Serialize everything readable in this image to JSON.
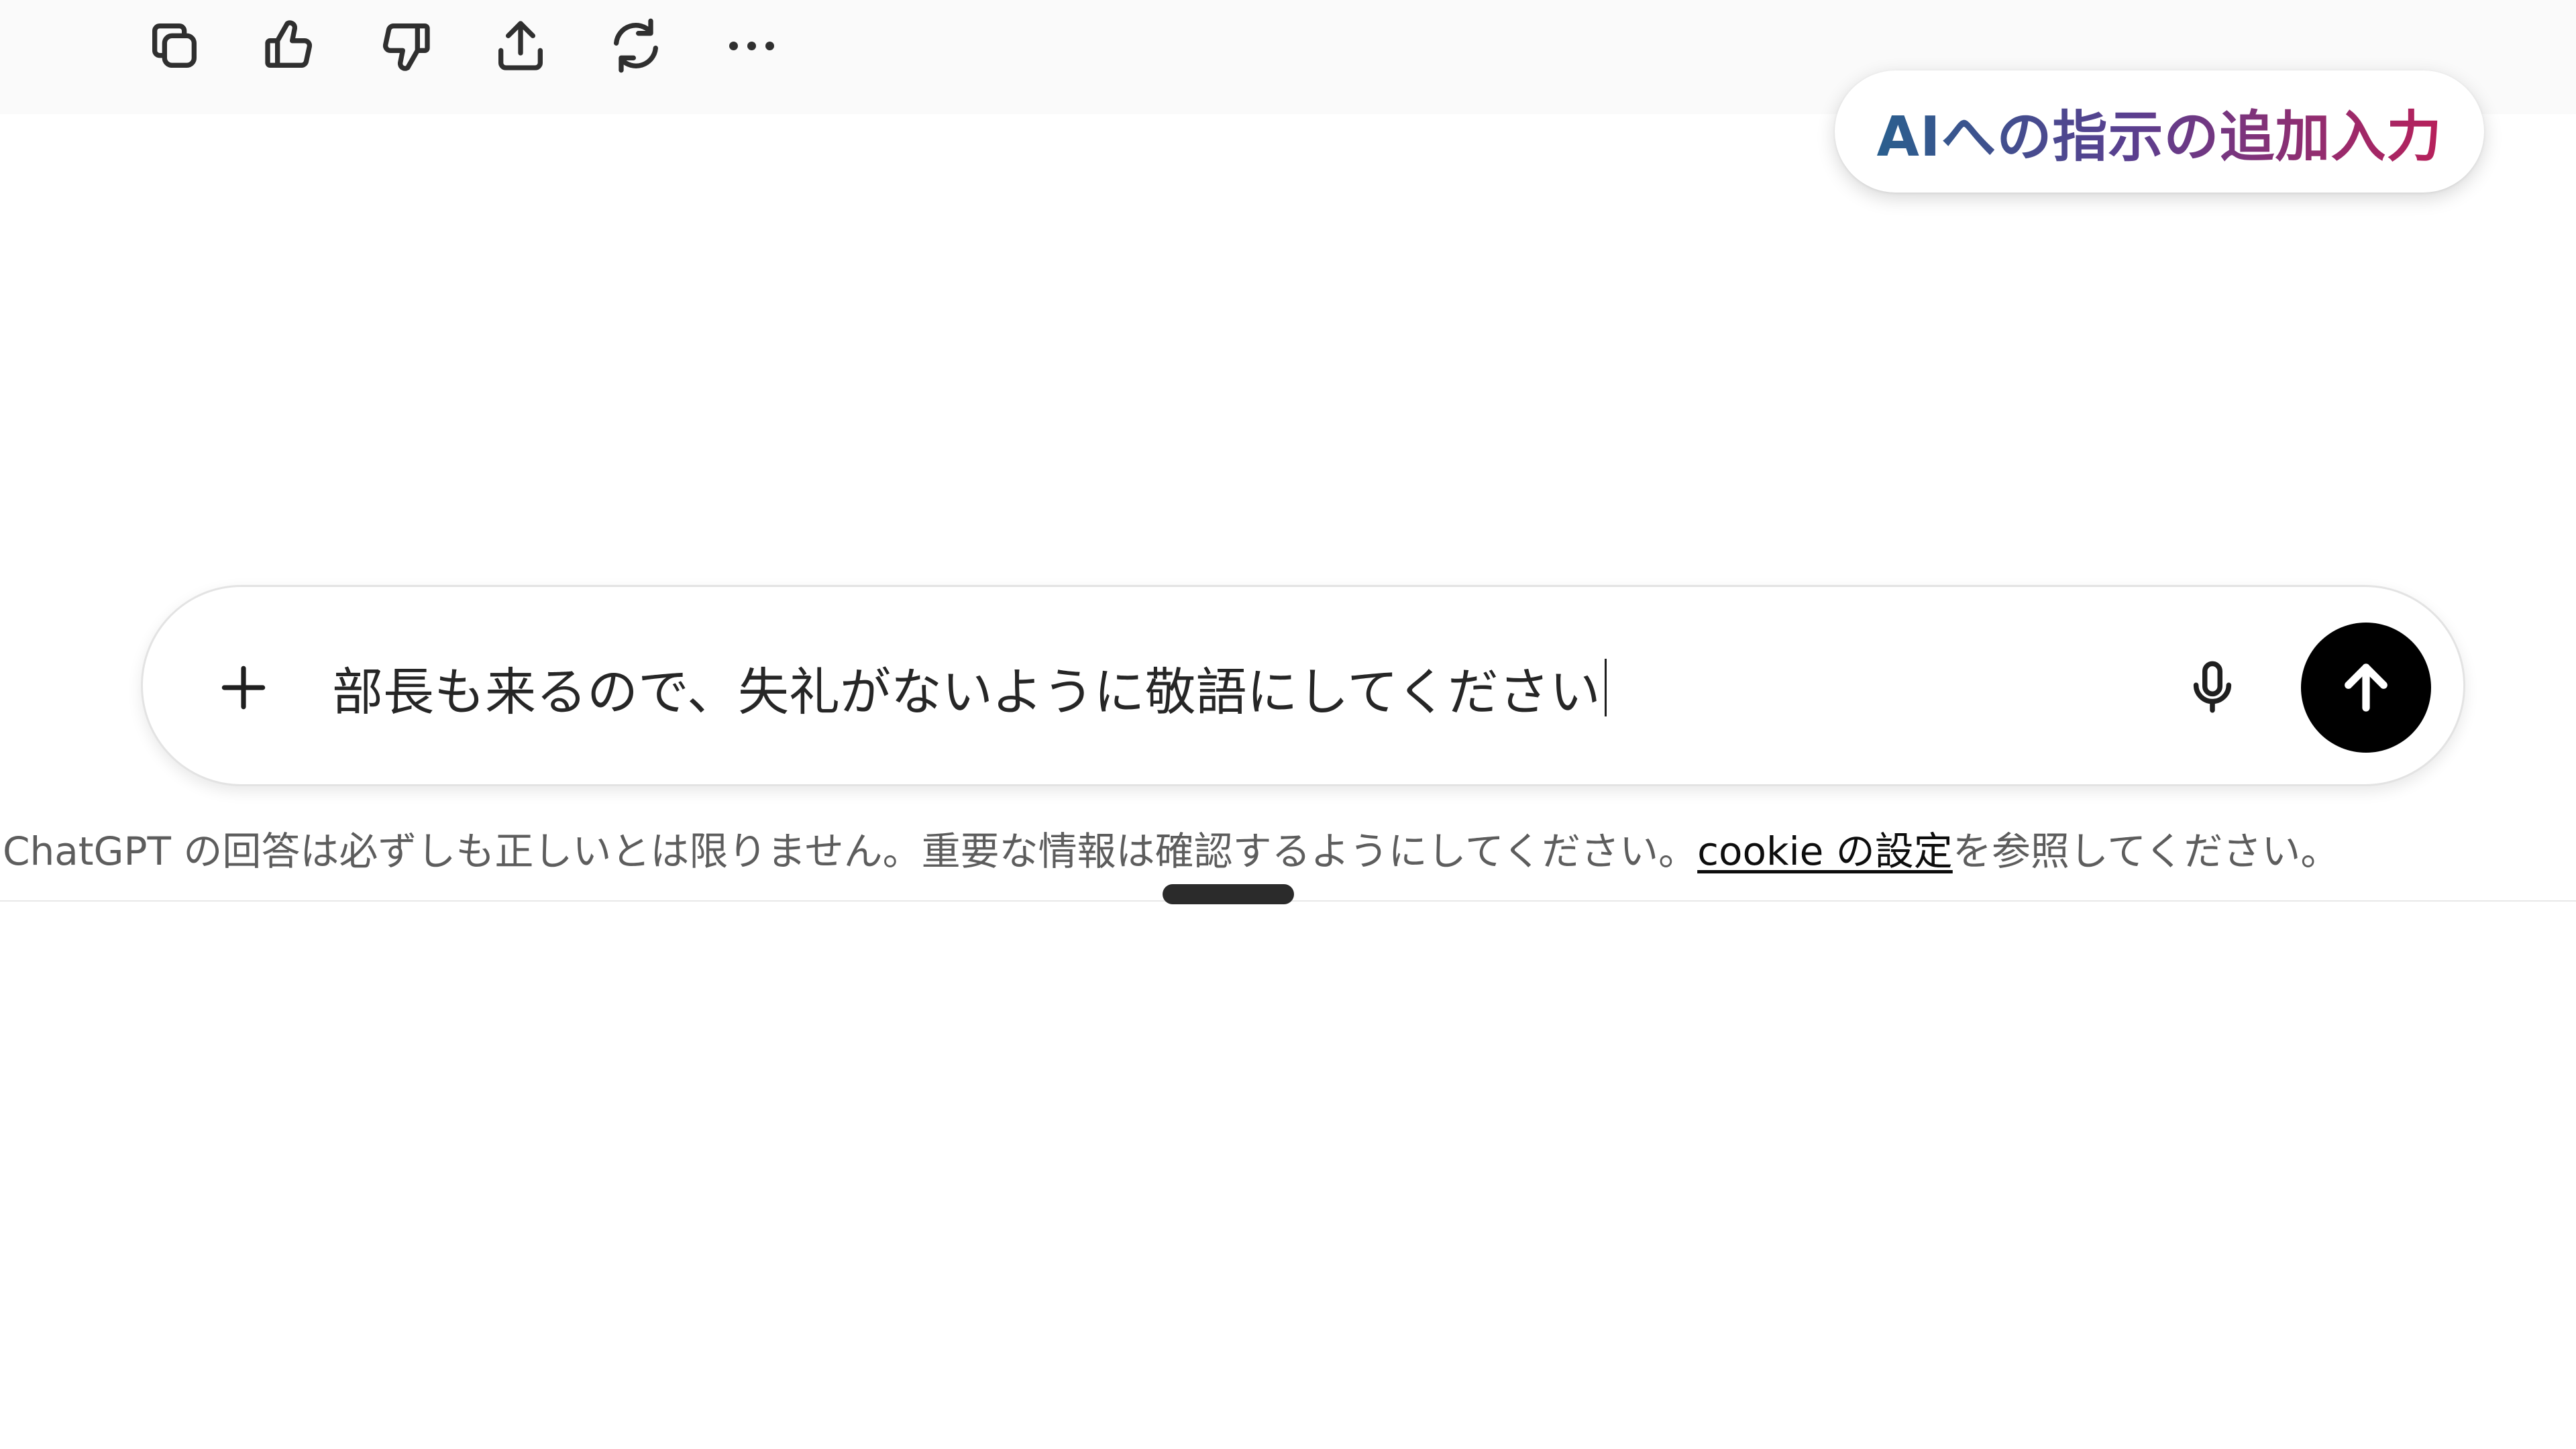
{
  "message_actions": [
    {
      "name": "copy",
      "icon": "copy-icon"
    },
    {
      "name": "good-response",
      "icon": "thumbs-up-icon"
    },
    {
      "name": "bad-response",
      "icon": "thumbs-down-icon"
    },
    {
      "name": "share",
      "icon": "share-icon"
    },
    {
      "name": "regenerate",
      "icon": "refresh-icon"
    },
    {
      "name": "more",
      "icon": "more-horizontal-icon"
    }
  ],
  "caption": {
    "text": "AIへの指示の追加入力"
  },
  "composer": {
    "prompt_text": "部長も来るので、失礼がないように敬語にしてください",
    "plus_icon": "plus-icon",
    "mic_icon": "microphone-icon",
    "send_icon": "arrow-up-icon"
  },
  "disclaimer": {
    "before_link": "ChatGPT の回答は必ずしも正しいとは限りません。重要な情報は確認するようにしてください。",
    "link_text": "cookie の設定",
    "after_link": "を参照してください。"
  },
  "colors": {
    "caption_gradient_start": "#2a5f8e",
    "caption_gradient_end": "#b8205a",
    "send_button": "#000000"
  }
}
